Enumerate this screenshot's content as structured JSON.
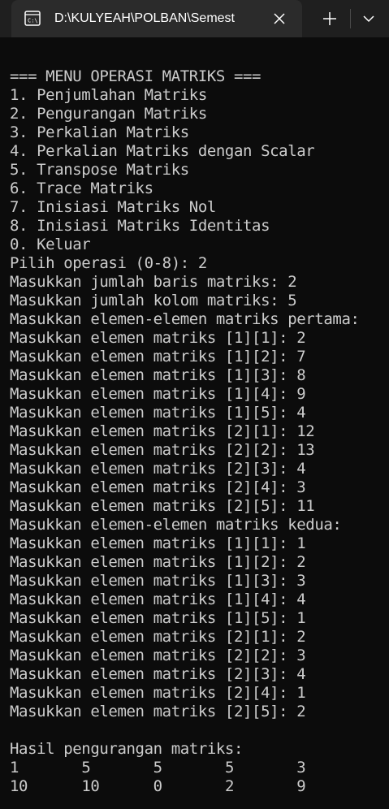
{
  "tab": {
    "title": "D:\\KULYEAH\\POLBAN\\Semest",
    "icon": "terminal-icon"
  },
  "toolbar": {
    "new_tab_icon": "plus-icon",
    "dropdown_icon": "chevron-down-icon"
  },
  "colors": {
    "tabbar_bg": "#1f1f1f",
    "tab_bg": "#2b2b2b",
    "terminal_bg": "#0c0c0c",
    "terminal_text": "#cccccc"
  },
  "terminal": {
    "lines": [
      "=== MENU OPERASI MATRIKS ===",
      "1. Penjumlahan Matriks",
      "2. Pengurangan Matriks",
      "3. Perkalian Matriks",
      "4. Perkalian Matriks dengan Scalar",
      "5. Transpose Matriks",
      "6. Trace Matriks",
      "7. Inisiasi Matriks Nol",
      "8. Inisiasi Matriks Identitas",
      "0. Keluar",
      "Pilih operasi (0-8): 2",
      "Masukkan jumlah baris matriks: 2",
      "Masukkan jumlah kolom matriks: 5",
      "Masukkan elemen-elemen matriks pertama:",
      "Masukkan elemen matriks [1][1]: 2",
      "Masukkan elemen matriks [1][2]: 7",
      "Masukkan elemen matriks [1][3]: 8",
      "Masukkan elemen matriks [1][4]: 9",
      "Masukkan elemen matriks [1][5]: 4",
      "Masukkan elemen matriks [2][1]: 12",
      "Masukkan elemen matriks [2][2]: 13",
      "Masukkan elemen matriks [2][3]: 4",
      "Masukkan elemen matriks [2][4]: 3",
      "Masukkan elemen matriks [2][5]: 11",
      "Masukkan elemen-elemen matriks kedua:",
      "Masukkan elemen matriks [1][1]: 1",
      "Masukkan elemen matriks [1][2]: 2",
      "Masukkan elemen matriks [1][3]: 3",
      "Masukkan elemen matriks [1][4]: 4",
      "Masukkan elemen matriks [1][5]: 1",
      "Masukkan elemen matriks [2][1]: 2",
      "Masukkan elemen matriks [2][2]: 3",
      "Masukkan elemen matriks [2][3]: 4",
      "Masukkan elemen matriks [2][4]: 1",
      "Masukkan elemen matriks [2][5]: 2",
      "",
      "Hasil pengurangan matriks:",
      "1\t5\t5\t5\t3",
      "10\t10\t0\t2\t9"
    ]
  }
}
